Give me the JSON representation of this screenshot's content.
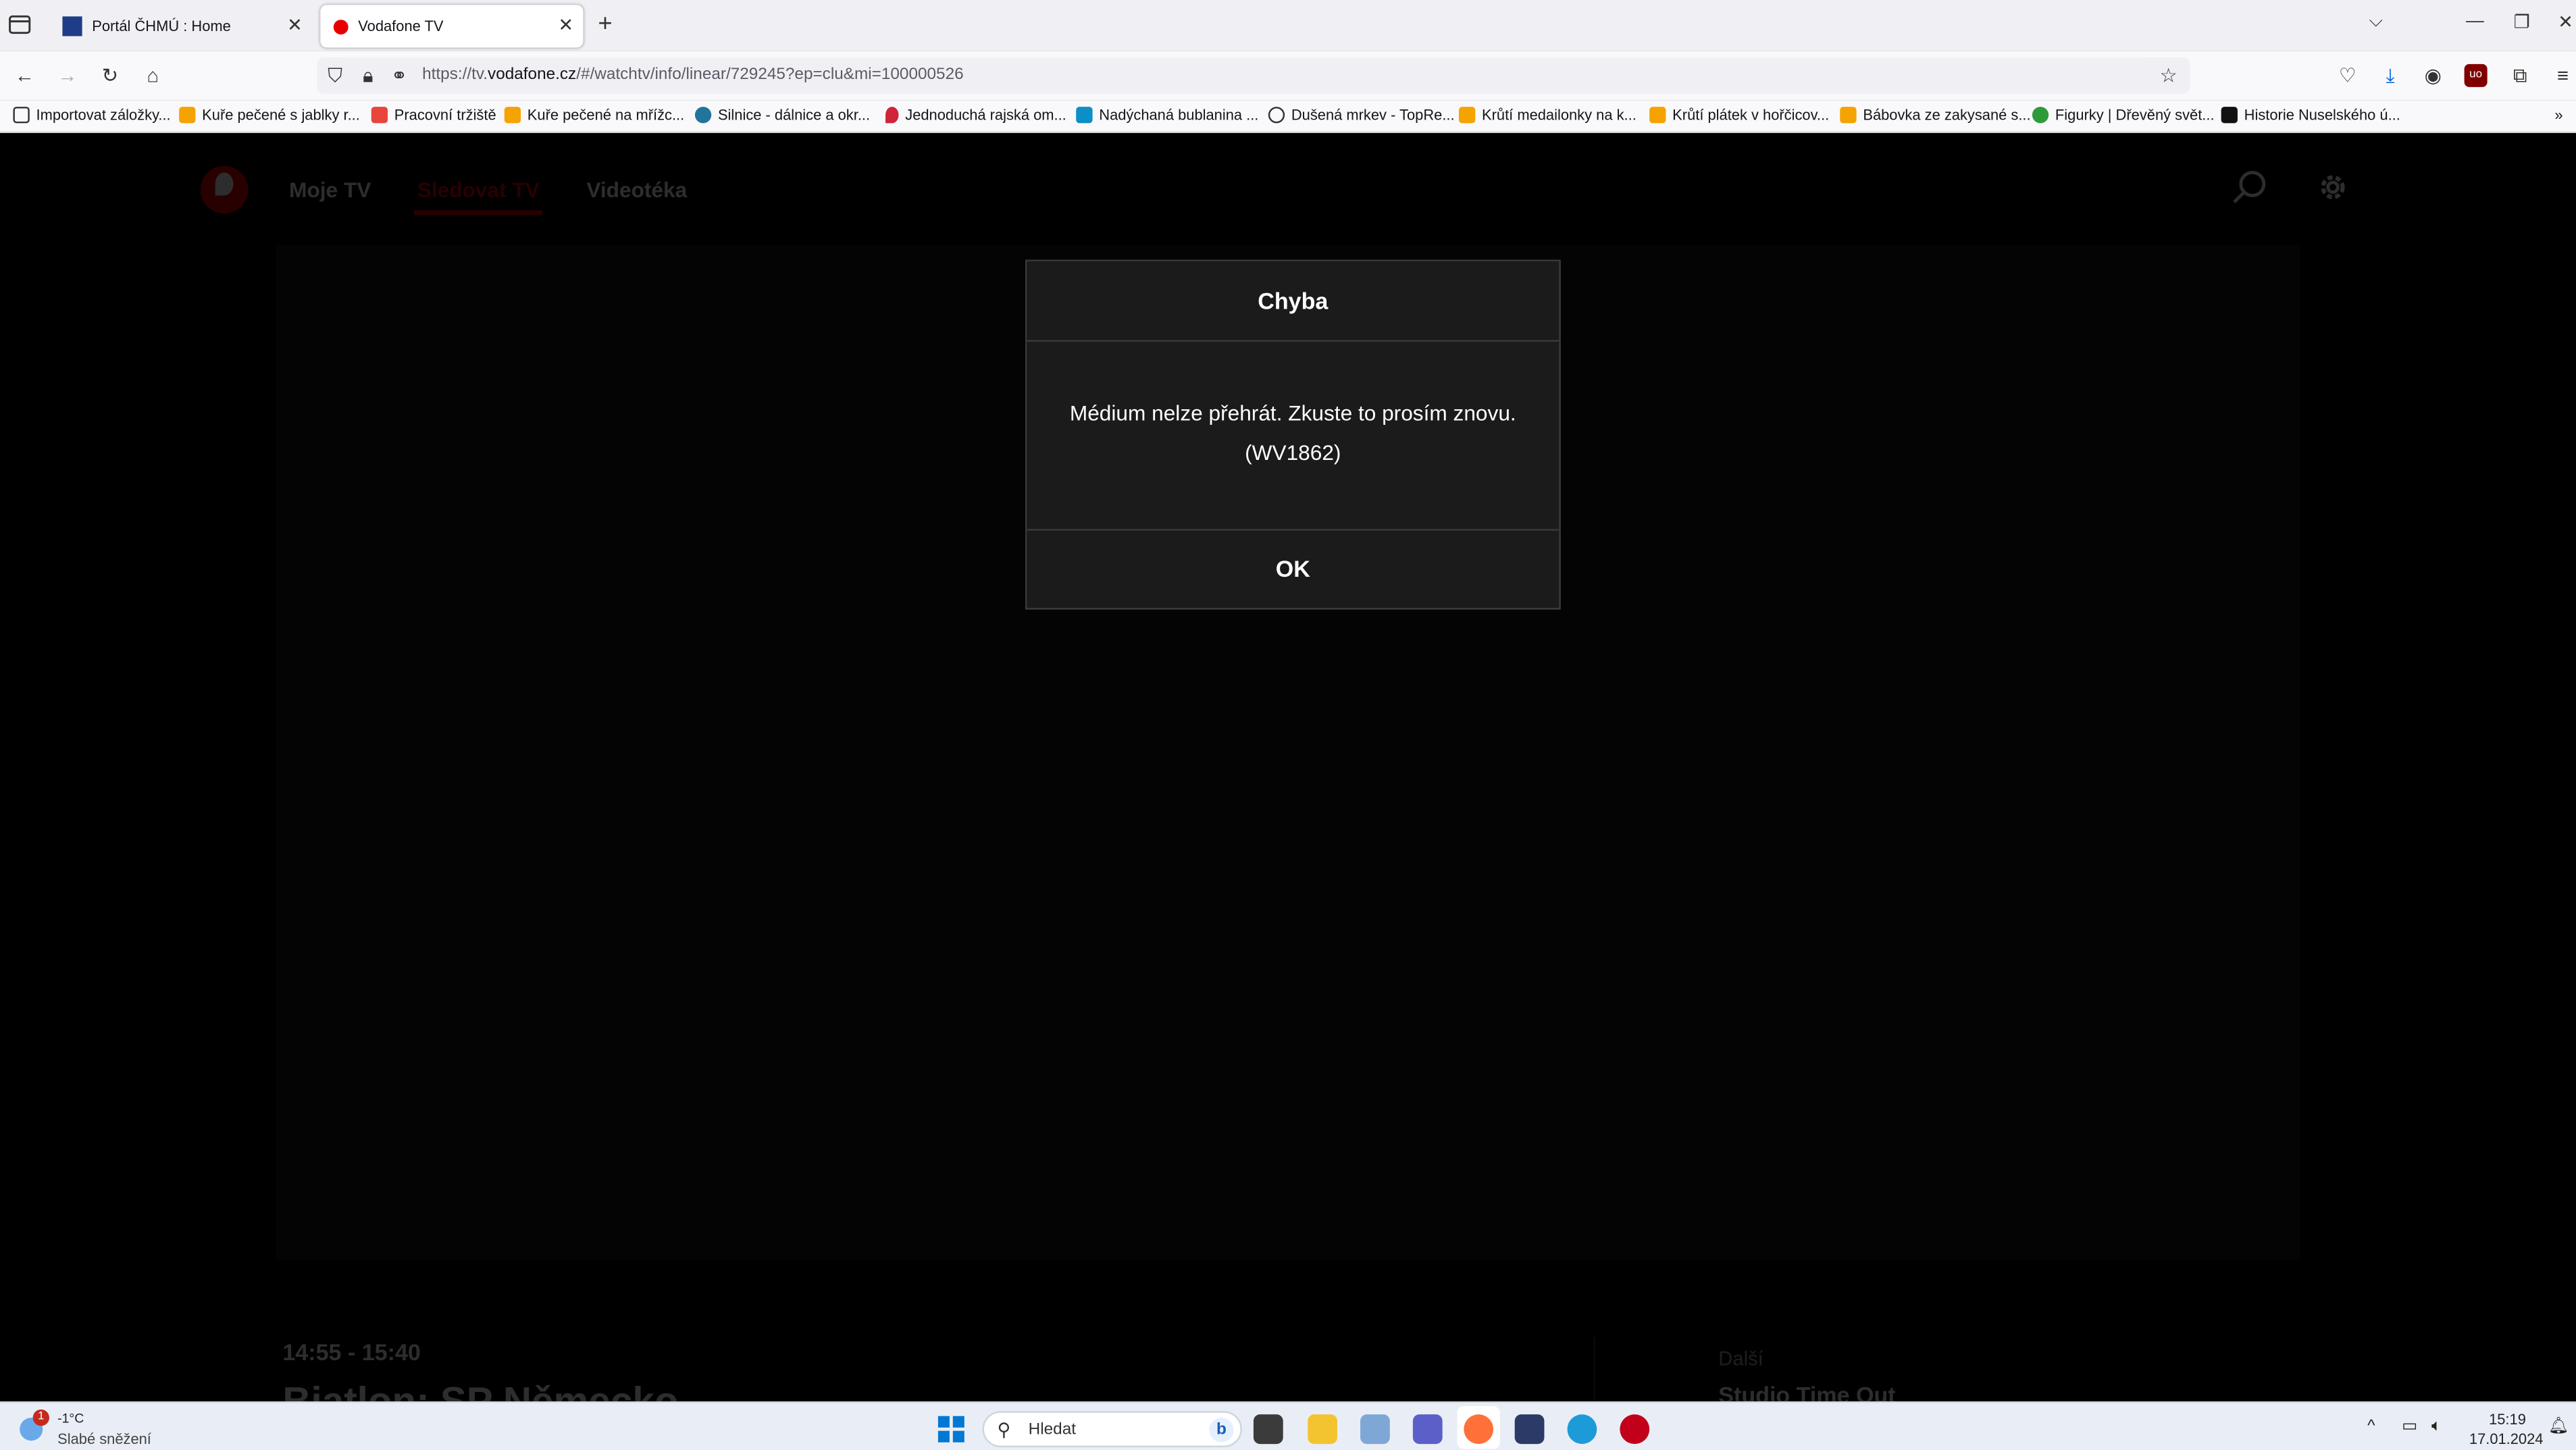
{
  "browser": {
    "tabs": [
      {
        "title": "Portál ČHMÚ : Home",
        "active": false
      },
      {
        "title": "Vodafone TV",
        "active": true
      }
    ],
    "url_prefix": "https://tv.",
    "url_domain": "vodafone.cz",
    "url_path": "/#/watchtv/info/linear/729245?ep=clu&mi=100000526",
    "bookmarks": [
      "Importovat záložky...",
      "Kuře pečené s jablky r...",
      "Pracovní tržiště",
      "Kuře pečené na mřížc...",
      "Silnice - dálnice a okr...",
      "Jednoduchá rajská om...",
      "Nadýchaná bublanina ...",
      "Dušená mrkev - TopRe...",
      "Krůtí medailonky na k...",
      "Krůtí plátek v hořčicov...",
      "Bábovka ze zakysané s...",
      "Figurky | Dřevěný svět...",
      "Historie Nuselského ú..."
    ]
  },
  "page": {
    "nav": [
      "Moje TV",
      "Sledovat TV",
      "Videotéka"
    ],
    "active_nav": "Sledovat TV",
    "time_range": "14:55 - 15:40",
    "program_title": "Biatlon: SP Německo",
    "next_label": "Další",
    "next_title": "Studio Time Out"
  },
  "dialog": {
    "title": "Chyba",
    "message_line1": "Médium nelze přehrát. Zkuste to prosím znovu.",
    "message_line2": "(WV1862)",
    "ok_label": "OK"
  },
  "taskbar": {
    "weather_badge": "1",
    "temperature": "-1°C",
    "weather_desc": "Slabé sněžení",
    "search_placeholder": "Hledat",
    "time": "15:19",
    "date": "17.01.2024"
  },
  "colors": {
    "vodafone_red": "#e60000",
    "dialog_bg": "#1b1b1b",
    "page_bg": "#000000"
  }
}
